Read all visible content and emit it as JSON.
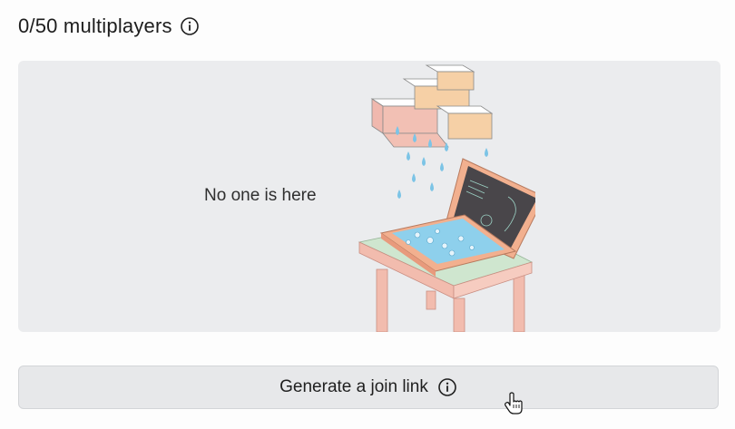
{
  "header": {
    "title": "0/50 multiplayers",
    "info_icon": "info-icon"
  },
  "panel": {
    "empty_message": "No one is here",
    "illustration": "rain-cloud-over-laptop-illustration"
  },
  "join_button": {
    "label": "Generate a join link",
    "info_icon": "info-icon"
  },
  "colors": {
    "background": "#fdfdfd",
    "panel": "#ebecee",
    "button": "#e7e8ea",
    "text": "#1f1f1f"
  }
}
